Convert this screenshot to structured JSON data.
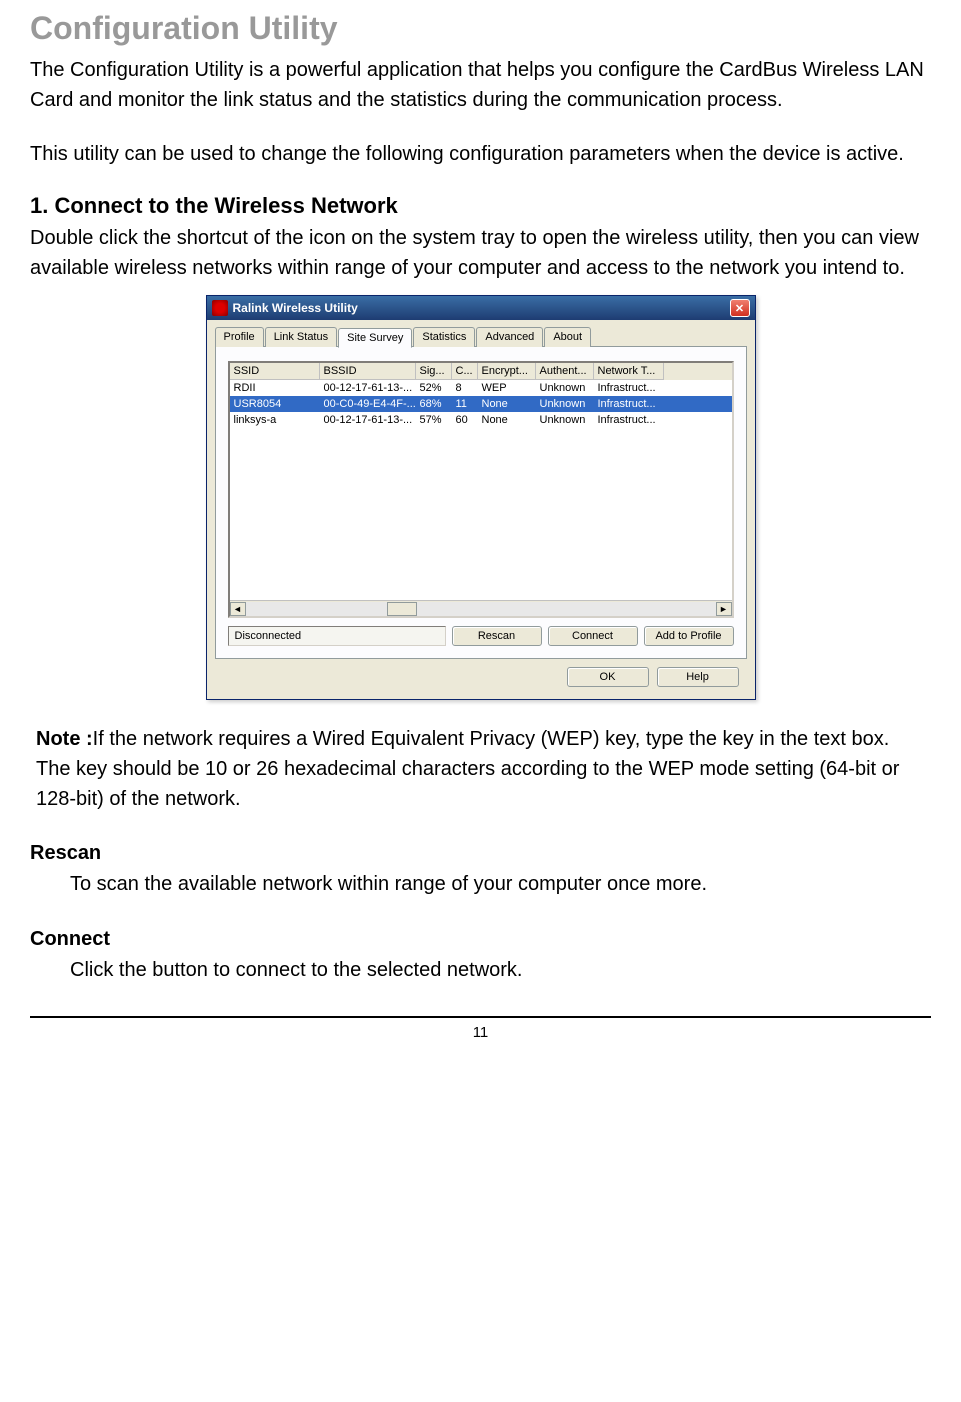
{
  "heading": "Configuration Utility",
  "paragraphs": {
    "p1": "The Configuration Utility is a powerful application that helps you configure the CardBus Wireless LAN Card and monitor the link status and the statistics during the communication process.",
    "p2": "This utility can be used to change the following configuration parameters when the device is active."
  },
  "section1": {
    "title": "1. Connect to the Wireless Network",
    "body": "Double click the shortcut of the icon on the system tray to open the wireless utility, then you can view available wireless networks within range of your computer and access to the network you intend to."
  },
  "window": {
    "title": "Ralink Wireless Utility",
    "tabs": [
      "Profile",
      "Link Status",
      "Site Survey",
      "Statistics",
      "Advanced",
      "About"
    ],
    "active_tab": 2,
    "columns": [
      "SSID",
      "BSSID",
      "Sig...",
      "C...",
      "Encrypt...",
      "Authent...",
      "Network T..."
    ],
    "rows": [
      {
        "ssid": "RDII",
        "bssid": "00-12-17-61-13-...",
        "sig": "52%",
        "ch": "8",
        "enc": "WEP",
        "auth": "Unknown",
        "net": "Infrastruct...",
        "selected": false
      },
      {
        "ssid": "USR8054",
        "bssid": "00-C0-49-E4-4F-...",
        "sig": "68%",
        "ch": "11",
        "enc": "None",
        "auth": "Unknown",
        "net": "Infrastruct...",
        "selected": true
      },
      {
        "ssid": "linksys-a",
        "bssid": "00-12-17-61-13-...",
        "sig": "57%",
        "ch": "60",
        "enc": "None",
        "auth": "Unknown",
        "net": "Infrastruct...",
        "selected": false
      }
    ],
    "status": "Disconnected",
    "buttons": {
      "rescan": "Rescan",
      "connect": "Connect",
      "add": "Add to Profile",
      "ok": "OK",
      "help": "Help"
    }
  },
  "note": {
    "label": "Note :",
    "text": "If the network requires a Wired Equivalent Privacy (WEP) key, type the key in the text box. The key should be 10 or 26 hexadecimal characters according to the WEP mode setting (64-bit or 128-bit) of the network."
  },
  "terms": {
    "rescan": {
      "label": "Rescan",
      "desc": "To scan the available network within range of your computer once more."
    },
    "connect": {
      "label": "Connect",
      "desc": "Click the button to connect to the selected network."
    }
  },
  "page_number": "11"
}
